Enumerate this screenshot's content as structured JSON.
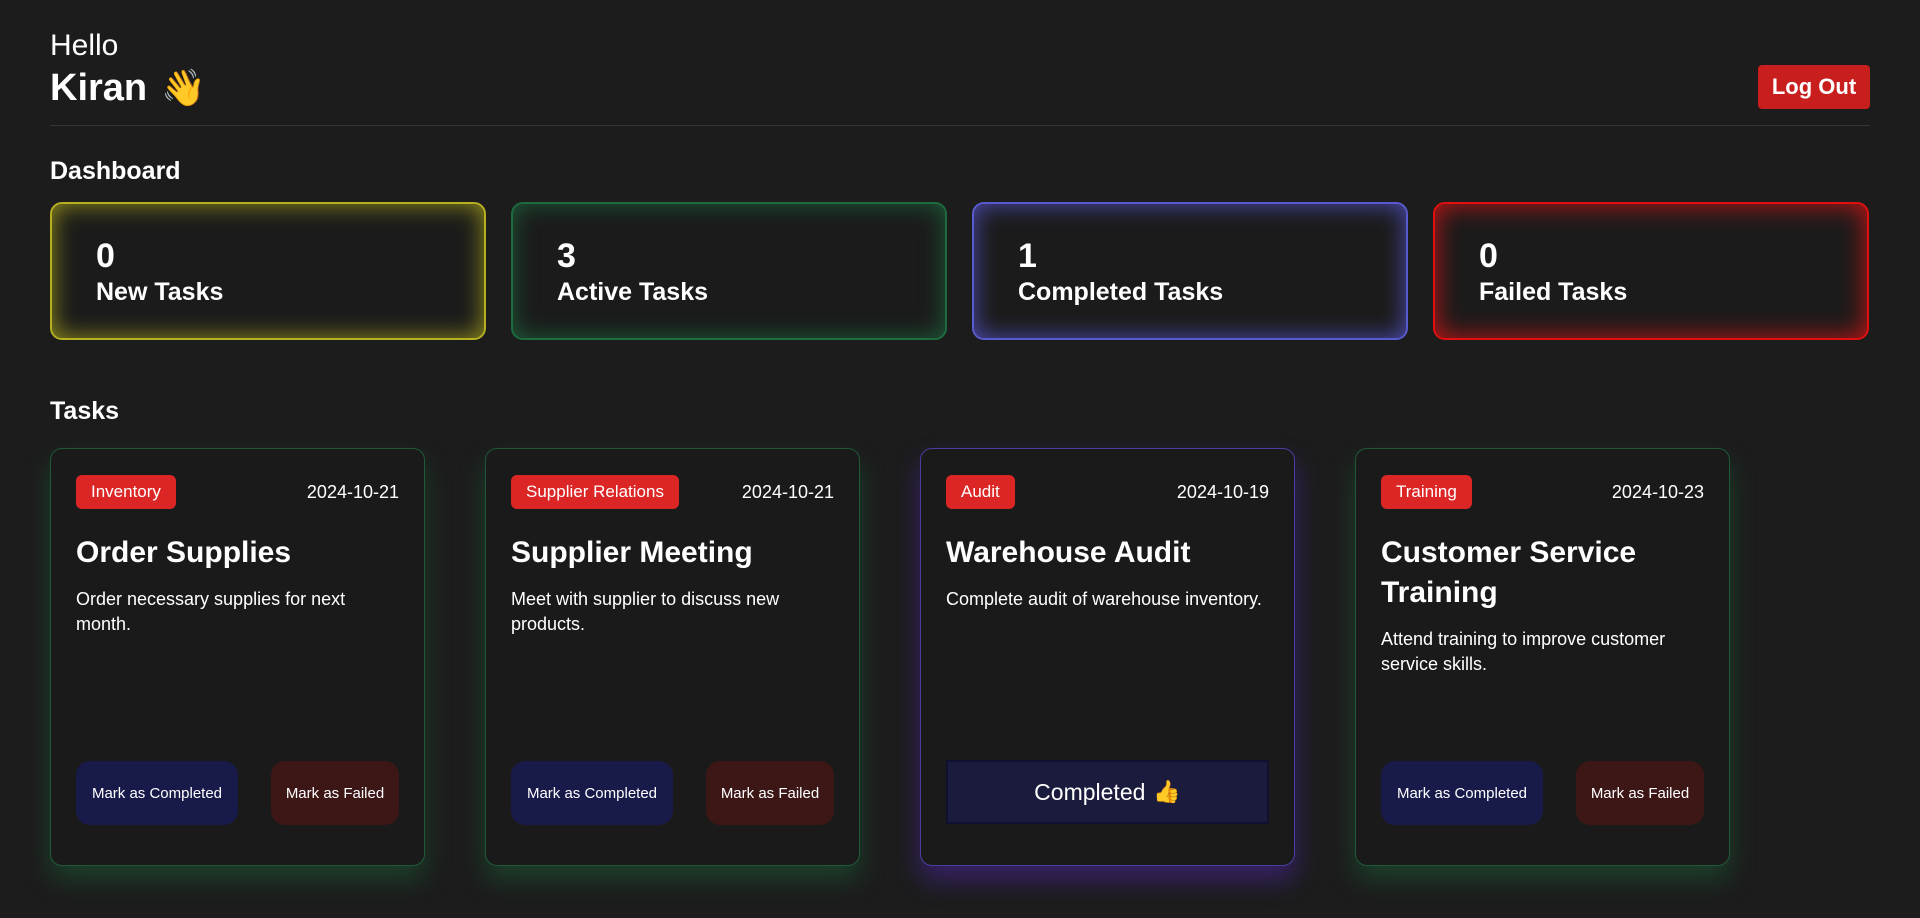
{
  "header": {
    "greeting": "Hello",
    "user_name": "Kiran",
    "wave_icon": "👋",
    "logout_label": "Log Out"
  },
  "dashboard": {
    "title": "Dashboard",
    "stats": [
      {
        "count": "0",
        "label": "New Tasks",
        "color": "#b4b020"
      },
      {
        "count": "3",
        "label": "Active Tasks",
        "color": "#1d6b3f"
      },
      {
        "count": "1",
        "label": "Completed Tasks",
        "color": "#5a5ad0"
      },
      {
        "count": "0",
        "label": "Failed Tasks",
        "color": "#e01010"
      }
    ]
  },
  "tasks": {
    "title": "Tasks",
    "items": [
      {
        "category": "Inventory",
        "date": "2024-10-21",
        "title": "Order Supplies",
        "description": "Order necessary supplies for next month.",
        "status": "active",
        "complete_label": "Mark as Completed",
        "fail_label": "Mark as Failed"
      },
      {
        "category": "Supplier Relations",
        "date": "2024-10-21",
        "title": "Supplier Meeting",
        "description": "Meet with supplier to discuss new products.",
        "status": "active",
        "complete_label": "Mark as Completed",
        "fail_label": "Mark as Failed"
      },
      {
        "category": "Audit",
        "date": "2024-10-19",
        "title": "Warehouse Audit",
        "description": "Complete audit of warehouse inventory.",
        "status": "completed",
        "status_label": "Completed",
        "status_icon": "👍"
      },
      {
        "category": "Training",
        "date": "2024-10-23",
        "title": "Customer Service Training",
        "description": "Attend training to improve customer service skills.",
        "status": "active",
        "complete_label": "Mark as Completed",
        "fail_label": "Mark as Failed"
      }
    ]
  },
  "colors": {
    "background": "#1c1c1c",
    "badge": "#dc2626",
    "logout": "#c81e1e",
    "complete_button": "#181a4a",
    "fail_button": "#3d1616"
  }
}
